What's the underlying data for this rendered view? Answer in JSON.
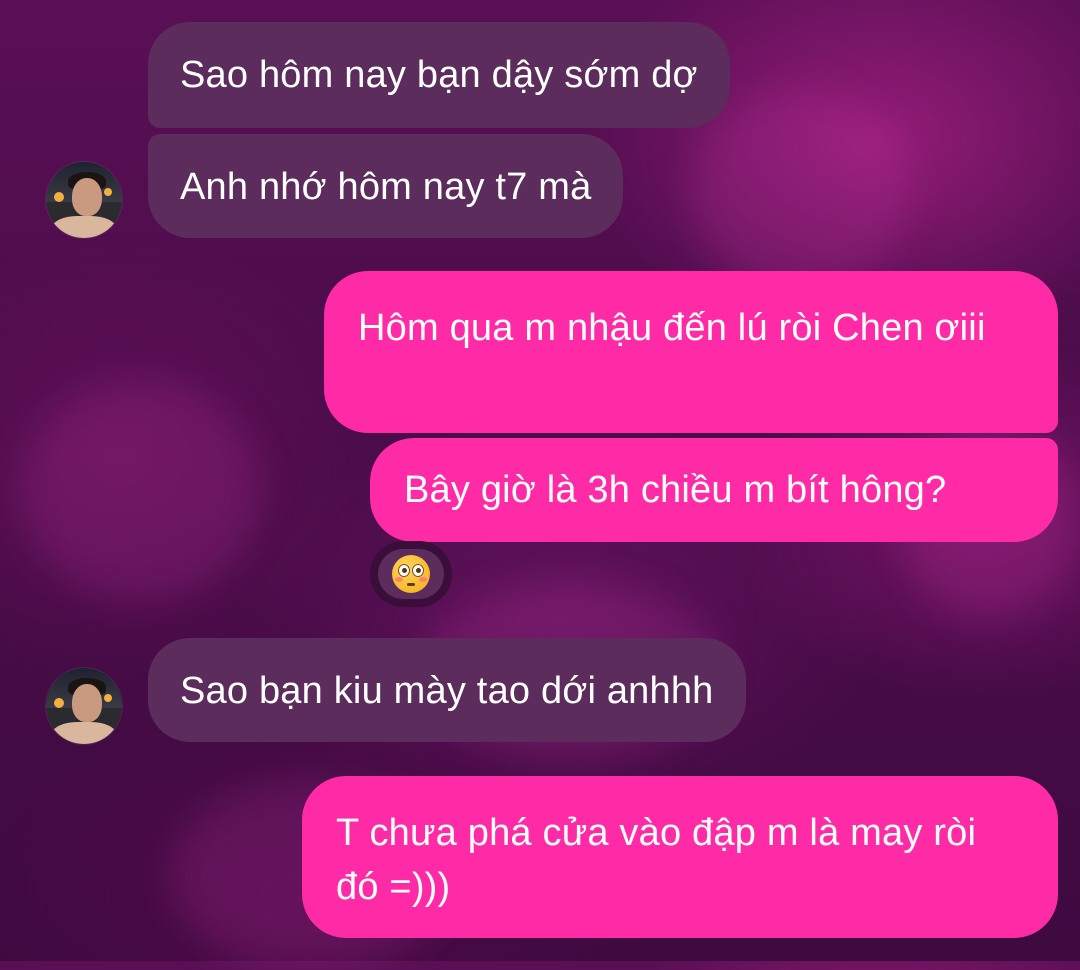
{
  "messages": [
    {
      "sender": "them",
      "text": "Sao hôm nay bạn dậy sớm dợ"
    },
    {
      "sender": "them",
      "text": "Anh nhớ hôm nay t7 mà"
    },
    {
      "sender": "me",
      "text": "Hôm qua m nhậu đến lú ròi Chen ơiii"
    },
    {
      "sender": "me",
      "text": "Bây giờ là 3h chiều m bít hông?"
    },
    {
      "sender": "them",
      "text": "Sao bạn kiu mày tao dới anhhh"
    },
    {
      "sender": "me",
      "text": "T chưa phá cửa vào đập m là may ròi đó =)))"
    }
  ],
  "reactions": {
    "message_4_reaction": "flushed-face-emoji"
  },
  "colors": {
    "incoming_bubble": "#5b2c5c",
    "outgoing_bubble": "#ff2aa6",
    "background": "#4a0c4a",
    "text": "#ffffff"
  },
  "icons": {
    "avatar": "contact-avatar-photo"
  }
}
